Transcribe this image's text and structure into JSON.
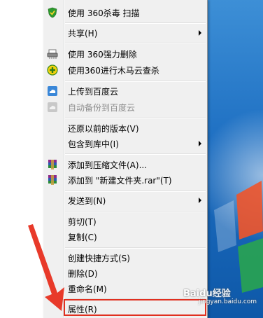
{
  "menu": {
    "items": [
      {
        "label": "使用 360杀毒 扫描",
        "icon": "shield-icon"
      },
      {
        "label": "共享(H)",
        "submenu": true
      },
      {
        "label": "使用 360强力删除",
        "icon": "shredder-icon"
      },
      {
        "label": "使用360进行木马云查杀",
        "icon": "trojan-scan-icon"
      },
      {
        "label": "上传到百度云",
        "icon": "cloud-upload-icon"
      },
      {
        "label": "自动备份到百度云",
        "icon": "cloud-backup-icon",
        "disabled": true
      },
      {
        "label": "还原以前的版本(V)"
      },
      {
        "label": "包含到库中(I)",
        "submenu": true
      },
      {
        "label": "添加到压缩文件(A)...",
        "icon": "winrar-icon"
      },
      {
        "label": "添加到 \"新建文件夹.rar\"(T)",
        "icon": "winrar-icon"
      },
      {
        "label": "发送到(N)",
        "submenu": true
      },
      {
        "label": "剪切(T)"
      },
      {
        "label": "复制(C)"
      },
      {
        "label": "创建快捷方式(S)"
      },
      {
        "label": "删除(D)"
      },
      {
        "label": "重命名(M)"
      },
      {
        "label": "属性(R)",
        "highlighted": true
      }
    ]
  },
  "watermark": {
    "text": "Baidu经验",
    "sub": "jingyan.baidu.com"
  },
  "colors": {
    "highlight": "#e03020",
    "desktop": "#1e6fc2"
  }
}
